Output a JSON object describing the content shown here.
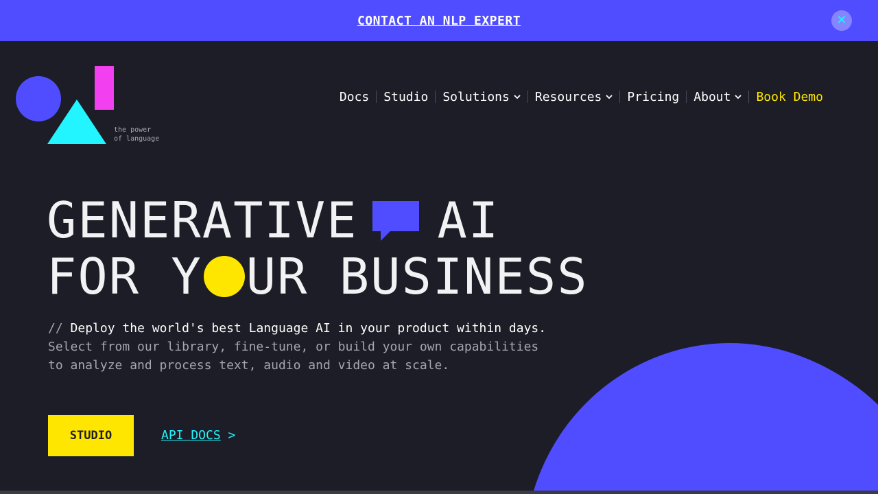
{
  "banner": {
    "link_label": "CONTACT AN NLP EXPERT",
    "close_label": "✕"
  },
  "logo": {
    "tagline_line1": "the power",
    "tagline_line2": "of language"
  },
  "nav": {
    "items": [
      {
        "label": "Docs",
        "has_dropdown": false
      },
      {
        "label": "Studio",
        "has_dropdown": false
      },
      {
        "label": "Solutions",
        "has_dropdown": true
      },
      {
        "label": "Resources",
        "has_dropdown": true
      },
      {
        "label": "Pricing",
        "has_dropdown": false
      },
      {
        "label": "About",
        "has_dropdown": true
      }
    ],
    "cta_label": "Book Demo"
  },
  "hero": {
    "line1_part1": "GENERATIVE",
    "line1_part2": "AI",
    "line2_part1": "FOR Y",
    "line2_part2": "UR BUSINESS",
    "sub_prefix": "//",
    "sub_lead": "Deploy the world's best Language AI in your product within days.",
    "sub_line2": "Select from our library, fine-tune, or build your own capabilities",
    "sub_line3": "to analyze and process text, audio and video at scale.",
    "primary_button": "STUDIO",
    "secondary_link": "API DOCS",
    "secondary_arrow": ">"
  },
  "colors": {
    "background": "#1c1d26",
    "brand_blue": "#4f4dff",
    "accent_yellow": "#ffe600",
    "accent_cyan": "#22f5ff",
    "accent_magenta": "#f23ff0"
  },
  "icons": [
    "close-icon",
    "chevron-down-icon",
    "speech-bubble-icon"
  ]
}
